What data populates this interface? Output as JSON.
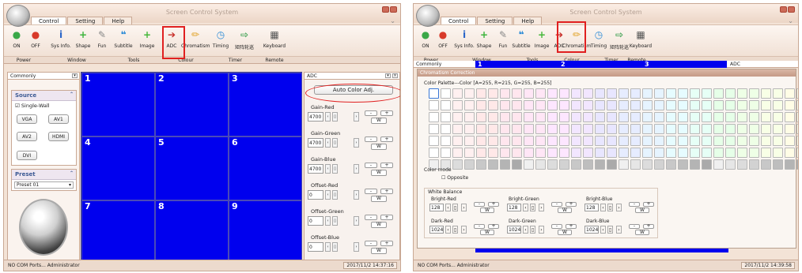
{
  "left_window": {
    "title": "Screen Control System",
    "tabs": [
      "Control",
      "Setting",
      "Help"
    ],
    "ribbon": [
      {
        "label": "ON",
        "icon": "on-toggle-icon",
        "color": "#3aa848"
      },
      {
        "label": "OFF",
        "icon": "off-toggle-icon",
        "color": "#d83a2a"
      },
      {
        "label": "Sys Info.",
        "icon": "info-icon",
        "color": "#2a66c8"
      },
      {
        "label": "Shape",
        "icon": "plus-icon",
        "color": "#3cb43c"
      },
      {
        "label": "Fun",
        "icon": "wrench-icon",
        "color": "#888888"
      },
      {
        "label": "Subtitle",
        "icon": "speech-bubble-icon",
        "color": "#2a8ad6"
      },
      {
        "label": "Image",
        "icon": "add-image-icon",
        "color": "#45b83a"
      },
      {
        "label": "ADC",
        "icon": "arrow-right-icon",
        "color": "#c8302a"
      },
      {
        "label": "Chromatism",
        "icon": "pencil-icon",
        "color": "#e0a020"
      },
      {
        "label": "Timing",
        "icon": "clock-bubble-icon",
        "color": "#2a8ad6"
      },
      {
        "label": "矩阵轮巡",
        "icon": "arrow-cycle-icon",
        "color": "#3ca050"
      },
      {
        "label": "Keyboard",
        "icon": "calculator-icon",
        "color": "#555555"
      }
    ],
    "groups": [
      "Power",
      "Window",
      "Tools",
      "Colour",
      "Timer",
      "Remote"
    ],
    "commonly_label": "Commonly",
    "source": {
      "title": "Source",
      "single_wall": "Single-Wall",
      "buttons": [
        "VGA",
        "AV1",
        "AV2",
        "HDMI",
        "DVI"
      ]
    },
    "preset": {
      "title": "Preset",
      "value": "Preset  01"
    },
    "screens": [
      "1",
      "2",
      "3",
      "4",
      "5",
      "6",
      "7",
      "8",
      "9"
    ],
    "adc": {
      "title": "ADC",
      "auto_button": "Auto Color Adj.",
      "rows": [
        {
          "label": "Gain-Red",
          "value": "4700"
        },
        {
          "label": "Gain-Green",
          "value": "4700"
        },
        {
          "label": "Gain-Blue",
          "value": "4700"
        },
        {
          "label": "Offset-Red",
          "value": "0"
        },
        {
          "label": "Offset-Green",
          "value": "0"
        },
        {
          "label": "Offset-Blue",
          "value": "0"
        }
      ],
      "minus": "-",
      "plus": "+",
      "w": "W"
    },
    "status_left": "NO COM Ports...  Administrator",
    "status_time": "2017/11/2 14:37:16"
  },
  "right_window": {
    "title": "Screen Control System",
    "tabs": [
      "Control",
      "Setting",
      "Help"
    ],
    "commonly_label": "Commonly",
    "adc_label": "ADC",
    "screen_numbers": [
      "1",
      "2",
      "3"
    ],
    "dialog_title": "Chromatism Correction",
    "palette_label": "Color Palette---Color [A=255, R=215, G=255, B=255]",
    "color_mode": "Color mode",
    "opposite": "Opposite",
    "white_balance": "White Balance",
    "wb": [
      {
        "label": "Bright-Red",
        "value": "128"
      },
      {
        "label": "Bright-Green",
        "value": "128"
      },
      {
        "label": "Bright-Blue",
        "value": "128"
      },
      {
        "label": "Dark-Red",
        "value": "1024"
      },
      {
        "label": "Dark-Green",
        "value": "1024"
      },
      {
        "label": "Dark-Blue",
        "value": "1024"
      }
    ],
    "status_left": "NO COM Ports...  Administrator",
    "status_time": "2017/11/2 14:39:58"
  },
  "palette_colors": [
    "#ffffff",
    "#fff0f0",
    "#ffe8e8",
    "#ffe6ee",
    "#ffe6f6",
    "#fde6ff",
    "#f2e6ff",
    "#e8e6ff",
    "#e6ecff",
    "#e6f4ff",
    "#e6fcff",
    "#e6fff6",
    "#e6ffe8",
    "#eeffe6",
    "#f8ffe6",
    "#fffde6"
  ]
}
